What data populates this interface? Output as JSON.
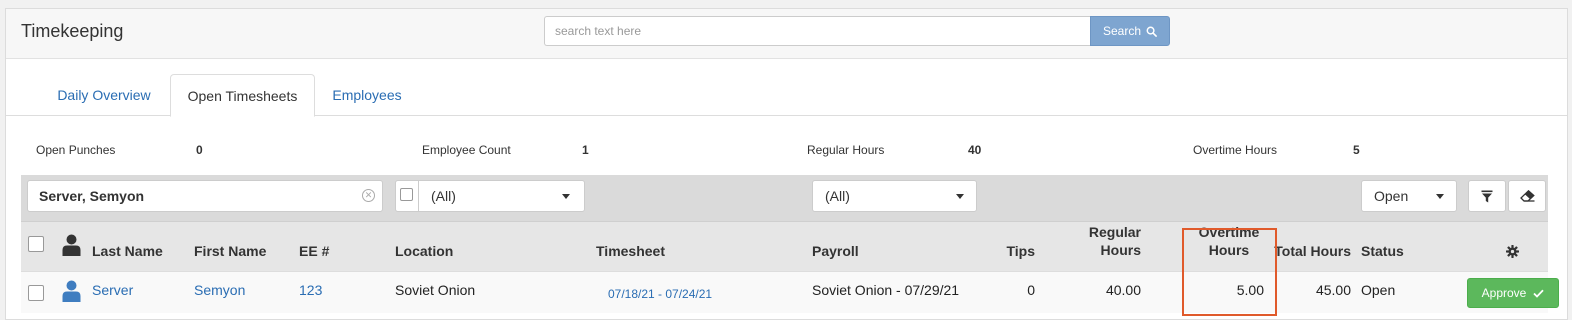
{
  "app": {
    "title": "Timekeeping"
  },
  "search": {
    "placeholder": "search text here",
    "button_label": "Search",
    "icon": "search-icon"
  },
  "tabs": [
    {
      "label": "Daily Overview",
      "active": false
    },
    {
      "label": "Open Timesheets",
      "active": true
    },
    {
      "label": "Employees",
      "active": false
    }
  ],
  "stats": [
    {
      "label": "Open Punches",
      "value": "0"
    },
    {
      "label": "Employee Count",
      "value": "1"
    },
    {
      "label": "Regular Hours",
      "value": "40"
    },
    {
      "label": "Overtime Hours",
      "value": "5"
    }
  ],
  "filters": {
    "name_value": "Server, Semyon",
    "location_value": "(All)",
    "payroll_value": "(All)",
    "status_value": "Open",
    "filter_icon": "filter-icon",
    "clear_icon": "eraser-icon"
  },
  "table": {
    "headers": {
      "last_name": "Last Name",
      "first_name": "First Name",
      "ee": "EE #",
      "location": "Location",
      "timesheet": "Timesheet",
      "payroll": "Payroll",
      "tips": "Tips",
      "regular_line1": "Regular",
      "regular_line2": "Hours",
      "overtime_line1": "Overtime",
      "overtime_line2": "Hours",
      "total": "Total Hours",
      "status": "Status",
      "settings_icon": "gear-icon"
    },
    "rows": [
      {
        "last_name": "Server",
        "first_name": "Semyon",
        "ee": "123",
        "location": "Soviet Onion",
        "timesheet": "07/18/21 - 07/24/21",
        "payroll": "Soviet Onion - 07/29/21",
        "tips": "0",
        "regular_hours": "40.00",
        "overtime_hours": "5.00",
        "total_hours": "45.00",
        "status": "Open",
        "action_label": "Approve"
      }
    ]
  },
  "colors": {
    "link": "#2a6db3",
    "search_button": "#7ea5d0",
    "approve": "#5cb85c",
    "highlight": "#e05a2b"
  }
}
